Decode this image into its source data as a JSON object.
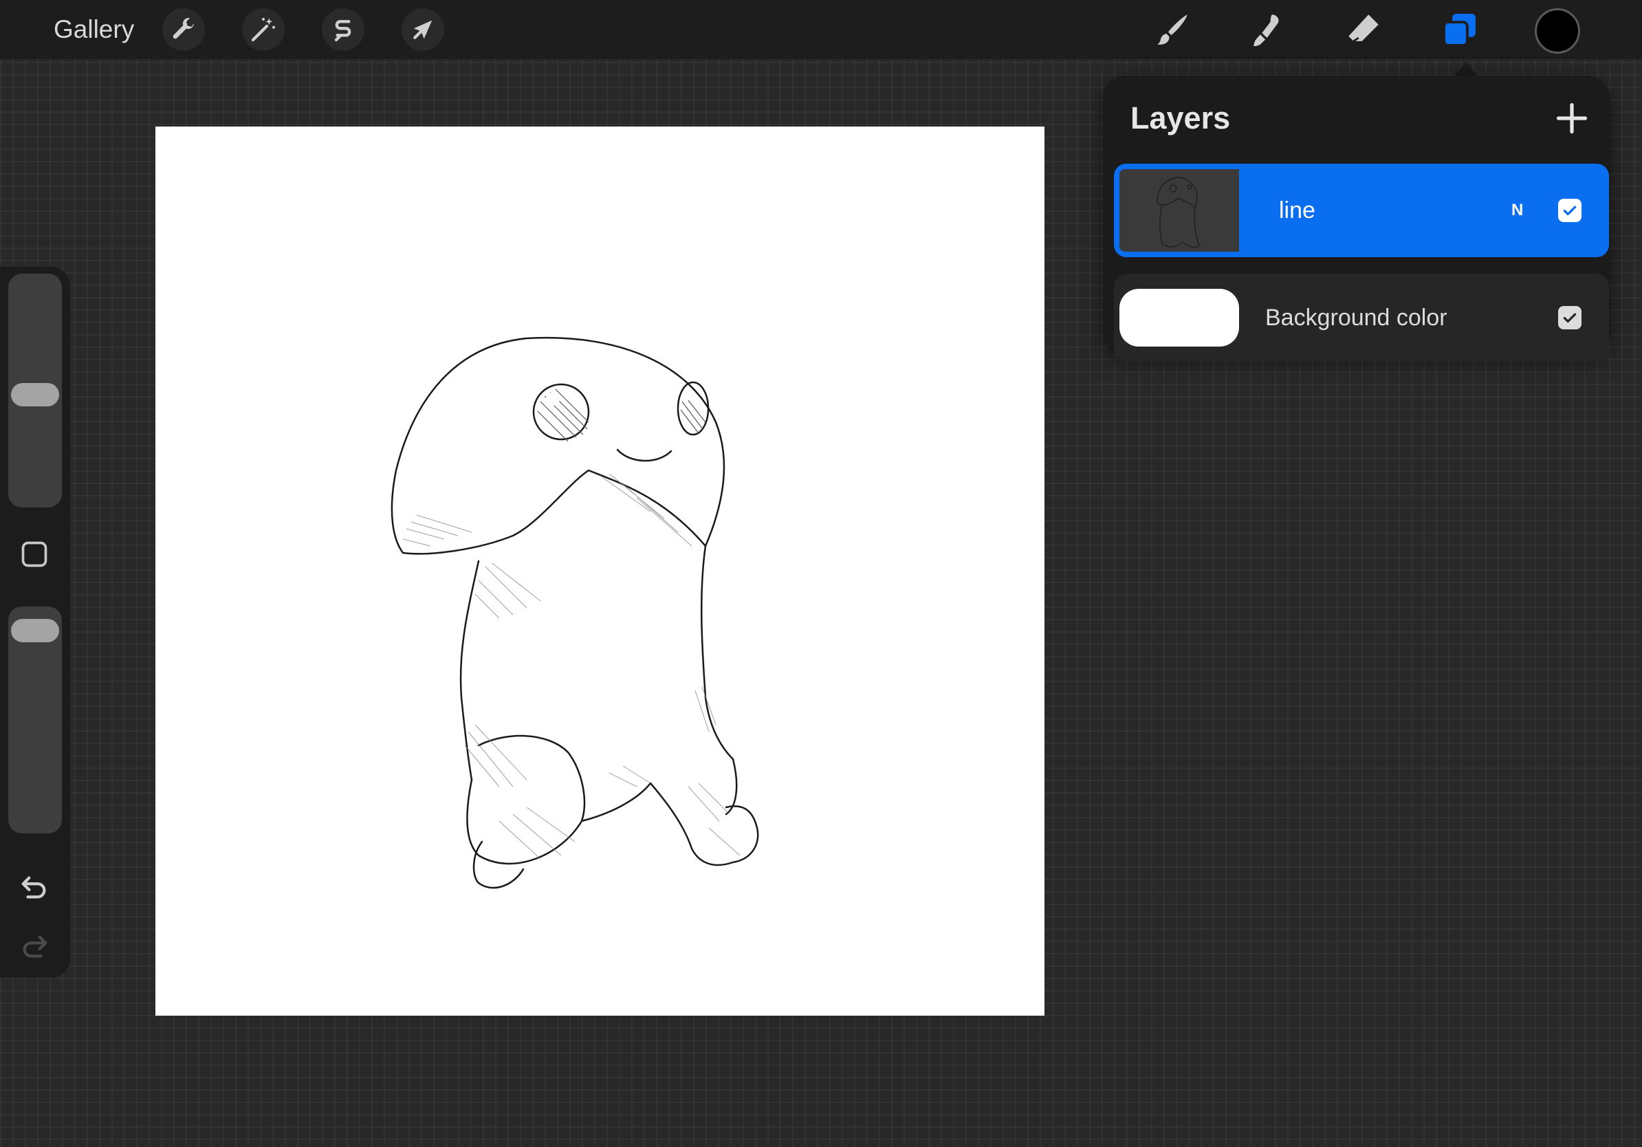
{
  "topbar": {
    "gallery_label": "Gallery",
    "actions_icon": "wrench-icon",
    "adjustments_icon": "magic-wand-icon",
    "selection_icon": "selection-s-icon",
    "transform_icon": "arrow-cursor-icon",
    "brush_icon": "brush-icon",
    "smudge_icon": "smudge-icon",
    "eraser_icon": "eraser-icon",
    "layers_icon": "layers-icon",
    "current_color": "#000000",
    "accent_color": "#0a6ef0"
  },
  "sidebar": {
    "brush_size_level": 0.48,
    "opacity_level": 0.95,
    "modify_icon": "square-icon",
    "undo_icon": "undo-icon",
    "redo_icon": "redo-icon"
  },
  "layers": {
    "title": "Layers",
    "add_icon": "plus-icon",
    "items": [
      {
        "name": "line",
        "blend_mode": "N",
        "visible": true,
        "selected": true
      },
      {
        "name": "Background color",
        "visible": true,
        "selected": false,
        "color": "#ffffff"
      }
    ]
  }
}
